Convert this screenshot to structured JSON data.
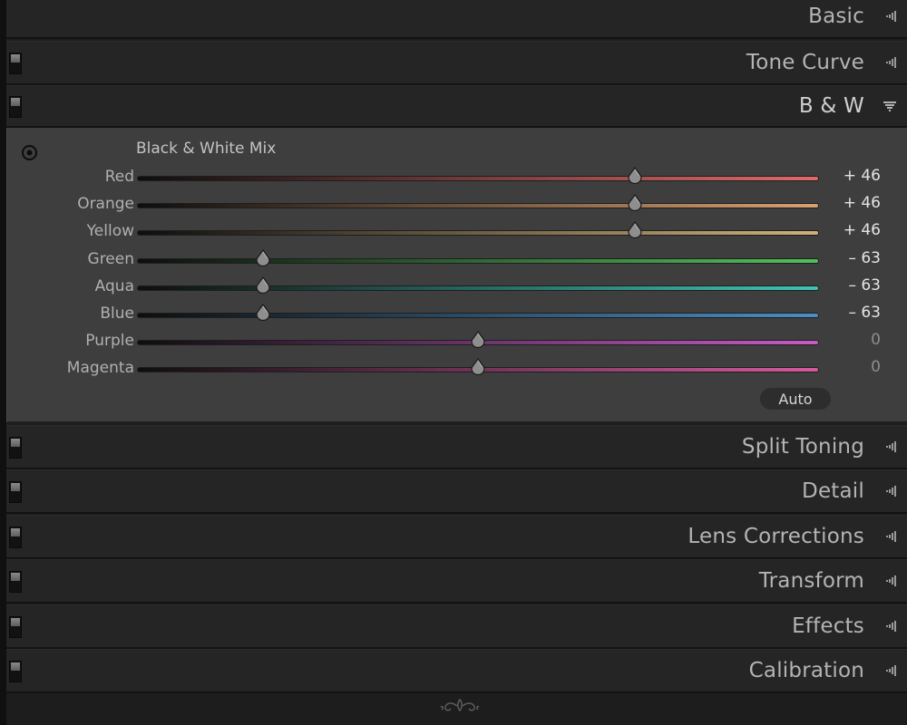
{
  "panels": {
    "basic": {
      "title": "Basic"
    },
    "tone_curve": {
      "title": "Tone Curve"
    },
    "bw": {
      "title": "B & W"
    },
    "split_toning": {
      "title": "Split Toning"
    },
    "detail": {
      "title": "Detail"
    },
    "lens_corrections": {
      "title": "Lens Corrections"
    },
    "transform": {
      "title": "Transform"
    },
    "effects": {
      "title": "Effects"
    },
    "calibration": {
      "title": "Calibration"
    }
  },
  "bw_mix": {
    "section_title": "Black & White Mix",
    "auto_label": "Auto",
    "sliders": [
      {
        "label": "Red",
        "value": 46,
        "display": "+ 46",
        "color": "#e06a6a"
      },
      {
        "label": "Orange",
        "value": 46,
        "display": "+ 46",
        "color": "#d9a070"
      },
      {
        "label": "Yellow",
        "value": 46,
        "display": "+ 46",
        "color": "#cfb27a"
      },
      {
        "label": "Green",
        "value": -63,
        "display": "– 63",
        "color": "#52c15a"
      },
      {
        "label": "Aqua",
        "value": -63,
        "display": "– 63",
        "color": "#3fc3b3"
      },
      {
        "label": "Blue",
        "value": -63,
        "display": "– 63",
        "color": "#4a8fc6"
      },
      {
        "label": "Purple",
        "value": 0,
        "display": "0",
        "color": "#c85bc8"
      },
      {
        "label": "Magenta",
        "value": 0,
        "display": "0",
        "color": "#d65a9e"
      }
    ],
    "range": [
      -100,
      100
    ]
  },
  "icons": {
    "collapsed": "triangle-left-icon",
    "expanded": "triangle-down-icon",
    "target": "target-adjustment-icon",
    "ornament": "panel-end-ornament-icon"
  },
  "colors": {
    "panel_header": "#252525",
    "panel_body": "#3e3e3e",
    "background": "#1d1d1d"
  }
}
